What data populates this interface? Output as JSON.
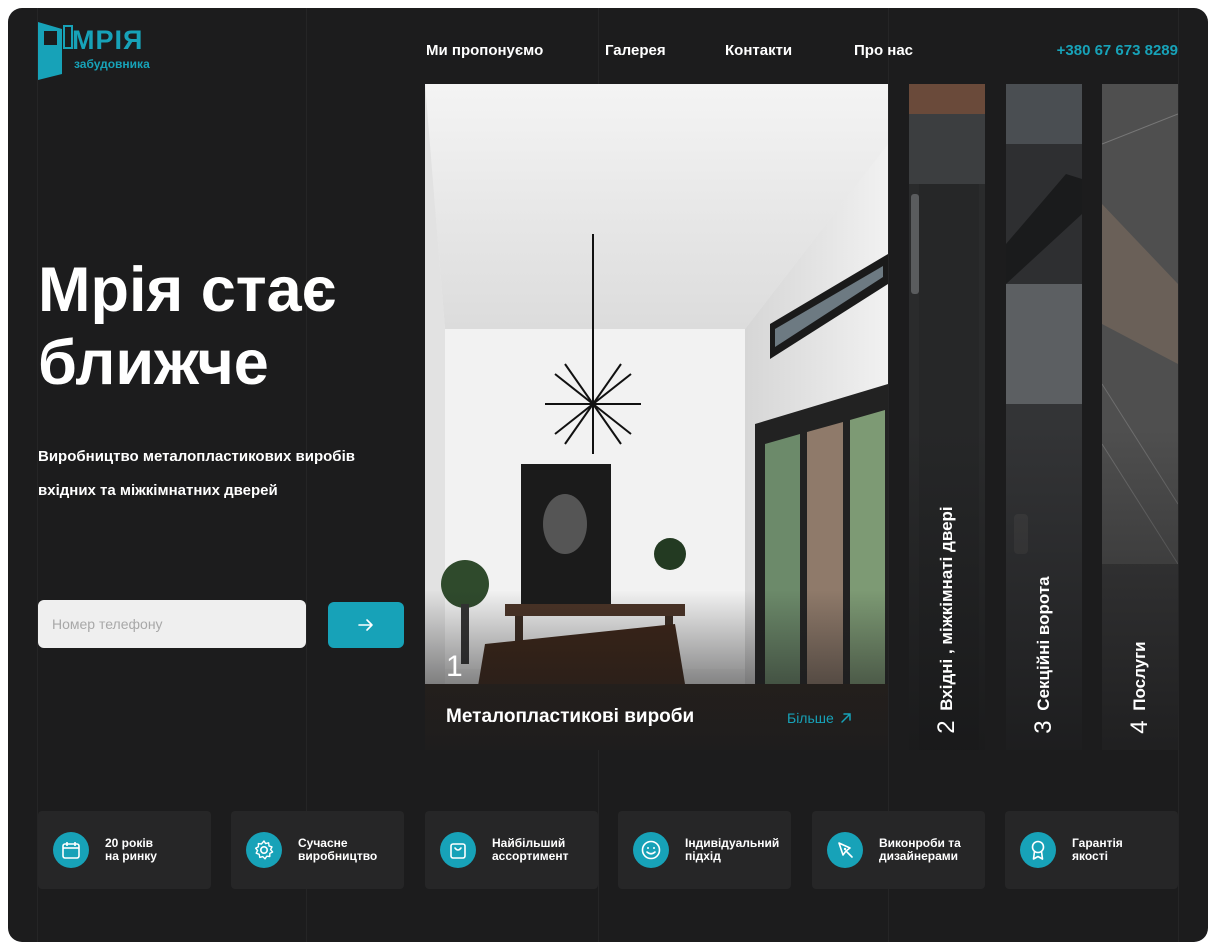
{
  "brand": {
    "name": "МРІЯ",
    "tagline": "забудовника",
    "accent_color": "#17a2b8"
  },
  "nav": {
    "items": [
      {
        "label": "Ми пропонуємо"
      },
      {
        "label": "Галерея"
      },
      {
        "label": "Контакти"
      },
      {
        "label": "Про нас"
      }
    ],
    "phone": "+380 67 673 8289"
  },
  "hero": {
    "title_line1": "Мрія стає",
    "title_line2": "ближче",
    "subtitle_line1": "Виробництво металопластикових виробів",
    "subtitle_line2": "вхідних та міжкімнатних дверей",
    "phone_placeholder": "Номер телефону",
    "submit_icon": "arrow-right-icon"
  },
  "categories": {
    "main": {
      "number": "1",
      "label": "Металопластикові вироби",
      "more_label": "Більше",
      "more_icon": "arrow-up-right-icon"
    },
    "strips": [
      {
        "number": "2",
        "label": "Вхідні , міжкімнаті двері"
      },
      {
        "number": "3",
        "label": "Секційні ворота"
      },
      {
        "number": "4",
        "label": "Послуги"
      }
    ]
  },
  "features": [
    {
      "icon": "calendar-icon",
      "line1": "20 років",
      "line2": "на ринку"
    },
    {
      "icon": "gear-icon",
      "line1": "Сучасне",
      "line2": "виробництво"
    },
    {
      "icon": "shopping-bag-icon",
      "line1": "Найбільший",
      "line2": "ассортимент"
    },
    {
      "icon": "smile-icon",
      "line1": "Індивідуальний",
      "line2": "підхід"
    },
    {
      "icon": "pen-tool-icon",
      "line1": "Виконроби та",
      "line2": "дизайнерами"
    },
    {
      "icon": "award-icon",
      "line1": "Гарантія",
      "line2": "якості"
    }
  ]
}
